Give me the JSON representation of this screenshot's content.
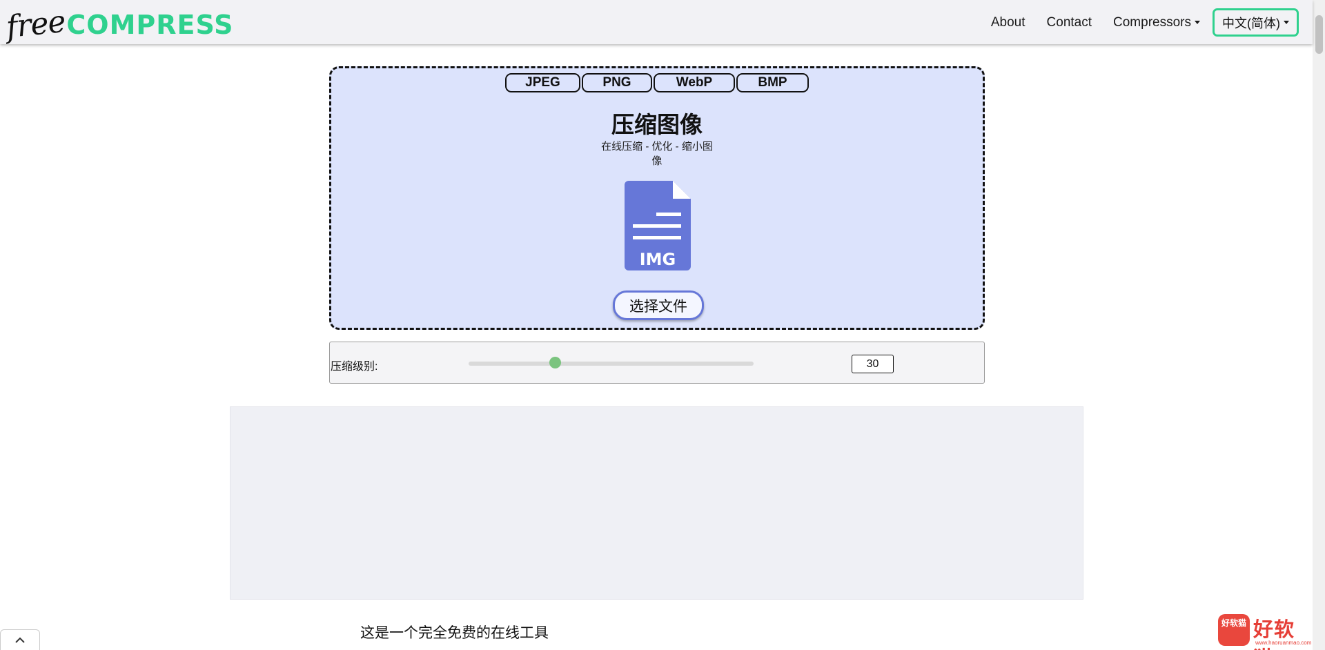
{
  "header": {
    "logo_free": "free",
    "logo_compress": "COMPRESS",
    "nav": {
      "about": "About",
      "contact": "Contact",
      "compressors": "Compressors",
      "language": "中文(简体)"
    }
  },
  "upload": {
    "formats": [
      "JPEG",
      "PNG",
      "WebP",
      "BMP"
    ],
    "title": "压缩图像",
    "subtitle": "在线压缩 - 优化 - 缩小图像",
    "icon_label": "IMG",
    "choose_button": "选择文件"
  },
  "compression": {
    "label": "压缩级别:",
    "value": "30",
    "slider_fraction": 0.3
  },
  "content": {
    "intro_text": "这是一个完全免费的在线工具"
  },
  "watermark": {
    "badge": "好软猫",
    "text": "好软猫",
    "url": "www.haoruanmao.com"
  },
  "colors": {
    "accent_green": "#2fd18e",
    "upload_bg": "#dce3fc",
    "icon_blue": "#6677d8",
    "slider_thumb": "#7bc47f"
  }
}
